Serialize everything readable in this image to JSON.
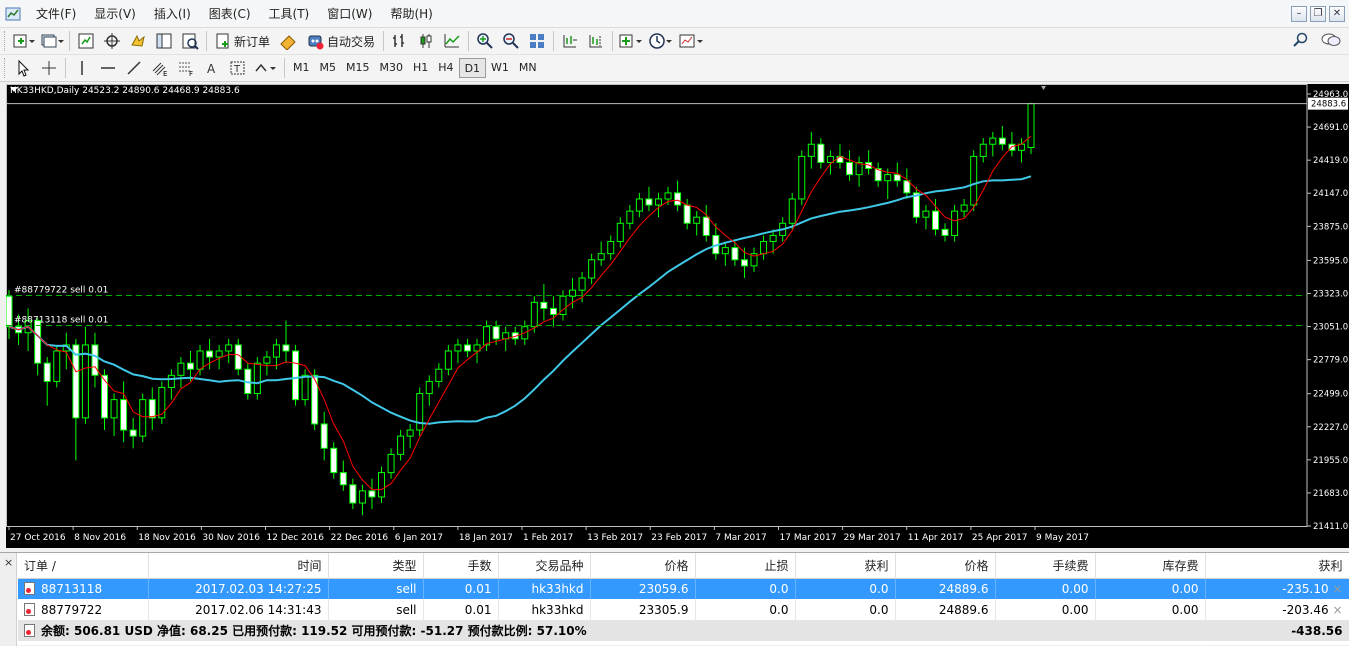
{
  "menu": [
    "文件(F)",
    "显示(V)",
    "插入(I)",
    "图表(C)",
    "工具(T)",
    "窗口(W)",
    "帮助(H)"
  ],
  "window_controls": [
    "–",
    "❐",
    "✕"
  ],
  "toolbar1": {
    "new_order": "新订单",
    "auto_trading": "自动交易"
  },
  "timeframes": [
    "M1",
    "M5",
    "M15",
    "M30",
    "H1",
    "H4",
    "D1",
    "W1",
    "MN"
  ],
  "active_timeframe": "D1",
  "chart": {
    "title": "HK33HKD,Daily  24523.2 24890.6 24468.9 24883.6",
    "current_price": "24883.6",
    "order_lines": [
      {
        "label": "#88779722 sell 0.01",
        "price": 23305.9
      },
      {
        "label": "#88713118 sell 0.01",
        "price": 23059.6
      }
    ],
    "colors": {
      "background": "#000000",
      "candle": "#00ff00",
      "ma_fast": "#ff0000",
      "ma_slow": "#40c8e8",
      "order_line": "#00b000"
    }
  },
  "chart_data": {
    "type": "candlestick",
    "symbol": "HK33HKD",
    "period": "Daily",
    "ohlc_last": {
      "open": 24523.2,
      "high": 24890.6,
      "low": 24468.9,
      "close": 24883.6
    },
    "ylim": [
      21411.0,
      24963.0
    ],
    "y_ticks": [
      "24963.0",
      "24691.0",
      "24419.0",
      "24147.0",
      "23875.0",
      "23595.0",
      "23323.0",
      "23051.0",
      "22779.0",
      "22499.0",
      "22227.0",
      "21955.0",
      "21683.0",
      "21411.0"
    ],
    "x_ticks": [
      "27 Oct 2016",
      "8 Nov 2016",
      "18 Nov 2016",
      "30 Nov 2016",
      "12 Dec 2016",
      "22 Dec 2016",
      "6 Jan 2017",
      "18 Jan 2017",
      "1 Feb 2017",
      "13 Feb 2017",
      "23 Feb 2017",
      "7 Mar 2017",
      "17 Mar 2017",
      "29 Mar 2017",
      "11 Apr 2017",
      "25 Apr 2017",
      "9 May 2017"
    ],
    "candles": [
      [
        23300,
        23350,
        22950,
        23050
      ],
      [
        23050,
        23150,
        22900,
        23000
      ],
      [
        23000,
        23200,
        22850,
        23100
      ],
      [
        23100,
        23120,
        22650,
        22750
      ],
      [
        22750,
        22800,
        22400,
        22600
      ],
      [
        22600,
        22900,
        22550,
        22850
      ],
      [
        22850,
        23000,
        22700,
        22900
      ],
      [
        22900,
        22950,
        21950,
        22300
      ],
      [
        22300,
        23050,
        22250,
        22900
      ],
      [
        22900,
        23000,
        22550,
        22650
      ],
      [
        22650,
        22700,
        22200,
        22300
      ],
      [
        22300,
        22500,
        22150,
        22450
      ],
      [
        22450,
        22600,
        22100,
        22200
      ],
      [
        22200,
        22300,
        22050,
        22150
      ],
      [
        22150,
        22500,
        22100,
        22450
      ],
      [
        22450,
        22550,
        22200,
        22300
      ],
      [
        22300,
        22600,
        22250,
        22550
      ],
      [
        22550,
        22700,
        22450,
        22650
      ],
      [
        22650,
        22800,
        22550,
        22750
      ],
      [
        22750,
        22850,
        22600,
        22700
      ],
      [
        22700,
        22900,
        22650,
        22850
      ],
      [
        22850,
        22950,
        22700,
        22800
      ],
      [
        22800,
        22900,
        22700,
        22850
      ],
      [
        22850,
        22950,
        22750,
        22900
      ],
      [
        22900,
        22950,
        22650,
        22700
      ],
      [
        22700,
        22750,
        22450,
        22500
      ],
      [
        22500,
        22800,
        22450,
        22750
      ],
      [
        22750,
        22850,
        22650,
        22800
      ],
      [
        22800,
        22950,
        22700,
        22900
      ],
      [
        22900,
        23100,
        22750,
        22850
      ],
      [
        22850,
        22900,
        22400,
        22450
      ],
      [
        22450,
        22700,
        22400,
        22650
      ],
      [
        22650,
        22700,
        22200,
        22250
      ],
      [
        22250,
        22350,
        21950,
        22050
      ],
      [
        22050,
        22100,
        21800,
        21850
      ],
      [
        21850,
        21950,
        21700,
        21750
      ],
      [
        21750,
        21800,
        21550,
        21600
      ],
      [
        21600,
        21750,
        21500,
        21700
      ],
      [
        21700,
        21800,
        21550,
        21650
      ],
      [
        21650,
        21900,
        21600,
        21850
      ],
      [
        21850,
        22050,
        21800,
        22000
      ],
      [
        22000,
        22200,
        21950,
        22150
      ],
      [
        22150,
        22250,
        22050,
        22200
      ],
      [
        22200,
        22550,
        22150,
        22500
      ],
      [
        22500,
        22650,
        22400,
        22600
      ],
      [
        22600,
        22750,
        22550,
        22700
      ],
      [
        22700,
        22900,
        22650,
        22850
      ],
      [
        22850,
        22950,
        22750,
        22900
      ],
      [
        22900,
        22950,
        22800,
        22850
      ],
      [
        22850,
        22950,
        22750,
        22900
      ],
      [
        22900,
        23100,
        22850,
        23050
      ],
      [
        23050,
        23100,
        22900,
        22950
      ],
      [
        22950,
        23050,
        22850,
        23000
      ],
      [
        23000,
        23050,
        22900,
        22950
      ],
      [
        22950,
        23100,
        22900,
        23050
      ],
      [
        23050,
        23300,
        23000,
        23250
      ],
      [
        23250,
        23400,
        23100,
        23200
      ],
      [
        23200,
        23300,
        23050,
        23150
      ],
      [
        23150,
        23350,
        23100,
        23300
      ],
      [
        23300,
        23450,
        23200,
        23350
      ],
      [
        23350,
        23500,
        23250,
        23450
      ],
      [
        23450,
        23650,
        23400,
        23600
      ],
      [
        23600,
        23750,
        23550,
        23650
      ],
      [
        23650,
        23800,
        23600,
        23750
      ],
      [
        23750,
        23950,
        23700,
        23900
      ],
      [
        23900,
        24050,
        23850,
        24000
      ],
      [
        24000,
        24150,
        23950,
        24100
      ],
      [
        24100,
        24200,
        24000,
        24050
      ],
      [
        24050,
        24150,
        23950,
        24100
      ],
      [
        24100,
        24200,
        24050,
        24150
      ],
      [
        24150,
        24250,
        24000,
        24050
      ],
      [
        24050,
        24100,
        23850,
        23900
      ],
      [
        23900,
        24000,
        23800,
        23950
      ],
      [
        23950,
        24050,
        23750,
        23800
      ],
      [
        23800,
        23900,
        23600,
        23650
      ],
      [
        23650,
        23750,
        23550,
        23700
      ],
      [
        23700,
        23750,
        23550,
        23600
      ],
      [
        23600,
        23700,
        23450,
        23550
      ],
      [
        23550,
        23700,
        23500,
        23650
      ],
      [
        23650,
        23800,
        23600,
        23750
      ],
      [
        23750,
        23850,
        23650,
        23800
      ],
      [
        23800,
        23950,
        23750,
        23900
      ],
      [
        23900,
        24150,
        23850,
        24100
      ],
      [
        24100,
        24500,
        24050,
        24450
      ],
      [
        24450,
        24650,
        24350,
        24550
      ],
      [
        24550,
        24600,
        24350,
        24400
      ],
      [
        24400,
        24500,
        24300,
        24450
      ],
      [
        24450,
        24550,
        24350,
        24400
      ],
      [
        24400,
        24500,
        24250,
        24300
      ],
      [
        24300,
        24450,
        24200,
        24400
      ],
      [
        24400,
        24500,
        24300,
        24350
      ],
      [
        24350,
        24400,
        24200,
        24250
      ],
      [
        24250,
        24350,
        24100,
        24300
      ],
      [
        24300,
        24400,
        24200,
        24250
      ],
      [
        24250,
        24350,
        24100,
        24150
      ],
      [
        24150,
        24200,
        23900,
        23950
      ],
      [
        23950,
        24050,
        23850,
        24000
      ],
      [
        24000,
        24100,
        23800,
        23850
      ],
      [
        23850,
        23900,
        23750,
        23800
      ],
      [
        23800,
        24050,
        23750,
        24000
      ],
      [
        24000,
        24100,
        23950,
        24050
      ],
      [
        24050,
        24500,
        24000,
        24450
      ],
      [
        24450,
        24600,
        24400,
        24550
      ],
      [
        24550,
        24650,
        24450,
        24600
      ],
      [
        24600,
        24700,
        24500,
        24550
      ],
      [
        24550,
        24650,
        24450,
        24500
      ],
      [
        24500,
        24600,
        24400,
        24550
      ],
      [
        24523.2,
        24890.6,
        24468.9,
        24883.6
      ]
    ]
  },
  "terminal": {
    "close_glyph": "×",
    "columns": [
      "订单  /",
      "时间",
      "类型",
      "手数",
      "交易品种",
      "价格",
      "止损",
      "获利",
      "价格",
      "手续费",
      "库存费",
      "获利"
    ],
    "rows": [
      [
        "88713118",
        "2017.02.03 14:27:25",
        "sell",
        "0.01",
        "hk33hkd",
        "23059.6",
        "0.0",
        "0.0",
        "24889.6",
        "0.00",
        "0.00",
        "-235.10"
      ],
      [
        "88779722",
        "2017.02.06 14:31:43",
        "sell",
        "0.01",
        "hk33hkd",
        "23305.9",
        "0.0",
        "0.0",
        "24889.6",
        "0.00",
        "0.00",
        "-203.46"
      ]
    ],
    "row_close_glyph": "×",
    "summary": "余额: 506.81 USD  净值: 68.25  已用预付款: 119.52  可用预付款: -51.27  预付款比例: 57.10%",
    "summary_total": "-438.56"
  }
}
